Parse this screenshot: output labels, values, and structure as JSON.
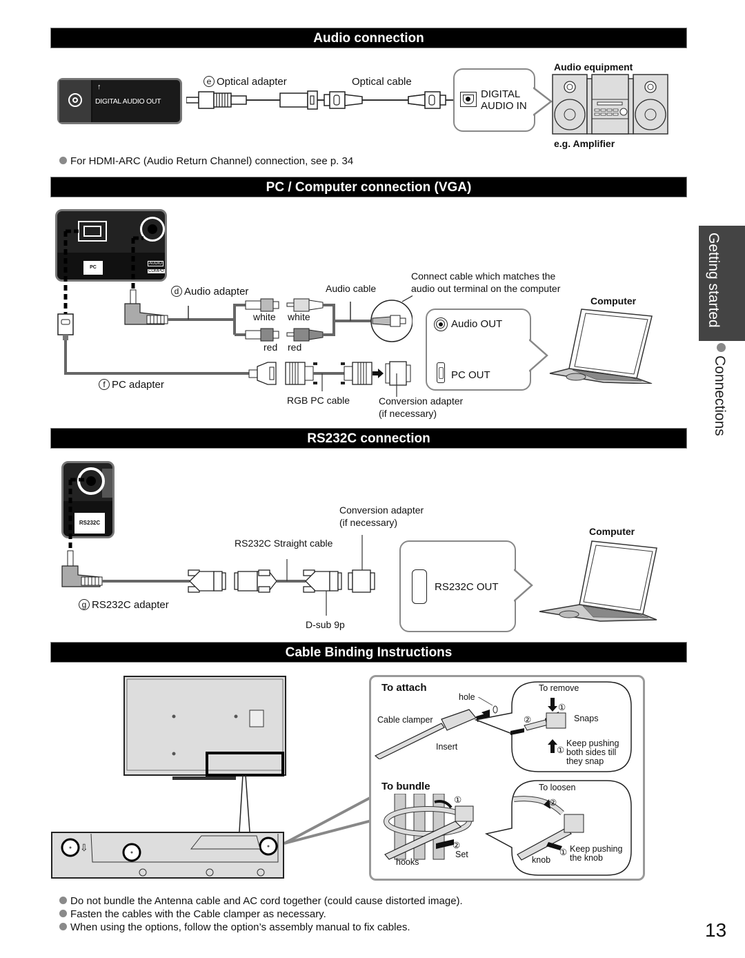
{
  "sections": {
    "audio": {
      "title": "Audio connection",
      "port_label": "DIGITAL AUDIO OUT",
      "adapter_marker": "e",
      "adapter_label": "Optical adapter",
      "cable_label": "Optical cable",
      "input_label_line1": "DIGITAL",
      "input_label_line2": "AUDIO IN",
      "equipment_label": "Audio equipment",
      "equipment_example": "e.g. Amplifier",
      "note": "For HDMI-ARC (Audio Return Channel) connection, see p. 34"
    },
    "pc": {
      "title": "PC / Computer connection (VGA)",
      "port_pc": "PC",
      "port_audio": "AUDIO",
      "port_comp": "COMPO",
      "audio_adapter_marker": "d",
      "audio_adapter_label": "Audio adapter",
      "audio_cable_label": "Audio cable",
      "callout_line1": "Connect cable which matches the",
      "callout_line2": "audio out terminal on the computer",
      "white_1": "white",
      "white_2": "white",
      "red_1": "red",
      "red_2": "red",
      "pc_adapter_marker": "f",
      "pc_adapter_label": "PC adapter",
      "rgb_cable_label": "RGB PC cable",
      "conversion_line1": "Conversion adapter",
      "conversion_line2": "(if necessary)",
      "audio_out_label": "Audio OUT",
      "pc_out_label": "PC OUT",
      "computer_label": "Computer"
    },
    "rs232c": {
      "title": "RS232C connection",
      "port_label": "RS232C",
      "conversion_line1": "Conversion adapter",
      "conversion_line2": "(if necessary)",
      "straight_cable_label": "RS232C Straight cable",
      "adapter_marker": "g",
      "adapter_label": "RS232C adapter",
      "dsub_label": "D-sub 9p",
      "out_label": "RS232C OUT",
      "computer_label": "Computer"
    },
    "cable_binding": {
      "title": "Cable Binding Instructions",
      "attach_title": "To attach",
      "hole_label": "hole",
      "clamper_label": "Cable clamper",
      "insert_label": "Insert",
      "remove_title": "To remove",
      "snaps_label": "Snaps",
      "step1": "①",
      "step2": "②",
      "keep_pushing_line1": "Keep pushing",
      "keep_pushing_line2": "both sides till",
      "keep_pushing_line3": "they snap",
      "bundle_title": "To bundle",
      "set_label": "Set",
      "hooks_label": "hooks",
      "loosen_title": "To loosen",
      "knob_label": "knob",
      "knob_push_line1": "Keep pushing",
      "knob_push_line2": "the knob"
    }
  },
  "notes": [
    "Do not bundle the Antenna cable and AC cord together (could cause distorted image).",
    "Fasten the cables with the Cable clamper as necessary.",
    "When using the options, follow the option’s assembly manual to fix cables."
  ],
  "side_tab": {
    "chapter": "Getting started",
    "section": "Connections"
  },
  "page_number": "13"
}
